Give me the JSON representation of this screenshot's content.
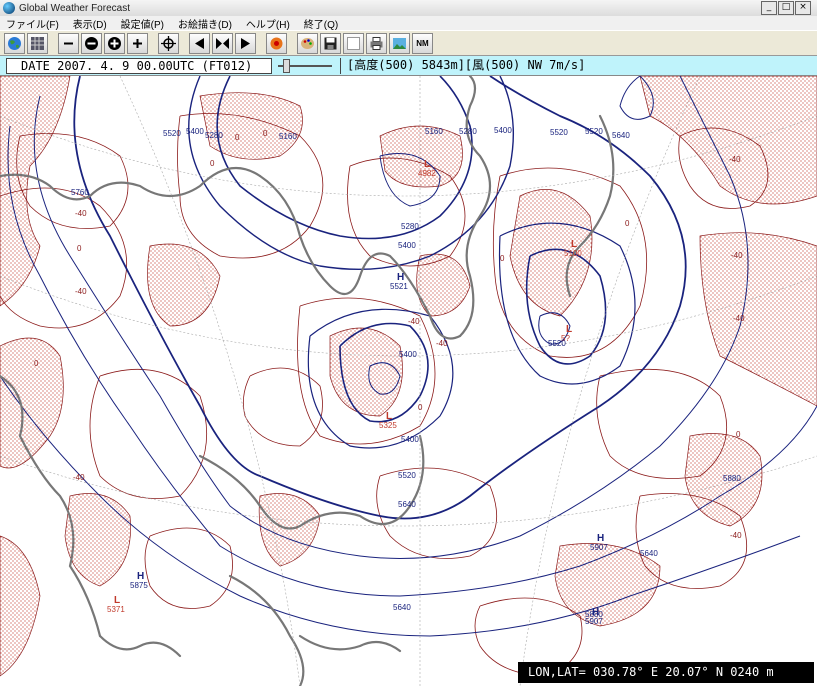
{
  "window": {
    "title": "Global Weather Forecast",
    "controls": [
      "_",
      "□",
      "×"
    ]
  },
  "menu": [
    "ファイル(F)",
    "表示(D)",
    "設定値(P)",
    "お絵描き(D)",
    "ヘルプ(H)",
    "終了(Q)"
  ],
  "toolbar": {
    "buttons": [
      "globe-icon",
      "grid-icon",
      "zoom-minus-icon",
      "zoom-out-icon",
      "zoom-in-icon",
      "zoom-plus-icon",
      "crosshair-icon",
      "prev-icon",
      "stop-icon",
      "next-icon",
      "settings-icon",
      "palette-icon",
      "save-icon",
      "blank-icon",
      "print-icon",
      "image-icon",
      "nm-icon"
    ],
    "nm_label": "NM"
  },
  "status": {
    "date": "DATE 2007. 4. 9 00.00UTC (FT012)",
    "info": "[高度(500) 5843m][風(500) NW  7m/s]"
  },
  "map": {
    "pressure_labels": [
      {
        "type": "L",
        "value": "4982"
      },
      {
        "type": "L",
        "value": "5100"
      },
      {
        "type": "L",
        "value": "5?"
      },
      {
        "type": "L",
        "value": "5325"
      },
      {
        "type": "L",
        "value": "5371"
      },
      {
        "type": "H",
        "value": "5521"
      },
      {
        "type": "H",
        "value": "5875"
      },
      {
        "type": "H",
        "value": "5907"
      },
      {
        "type": "H",
        "value": "5907"
      }
    ],
    "contour_labels": [
      "5520",
      "5400",
      "5280",
      "5160",
      "5160",
      "5280",
      "5400",
      "5520",
      "5640",
      "5760",
      "5280",
      "5400",
      "5400",
      "5400",
      "5520",
      "5640",
      "5880",
      "5640",
      "5880",
      "5520",
      "5520",
      "5640"
    ],
    "temp_labels": [
      "-40",
      "-40",
      "-40",
      "-40",
      "-40",
      "-40",
      "-40",
      "-40",
      "-40",
      "0",
      "0",
      "0",
      "0",
      "0",
      "0",
      "0",
      "0",
      "0"
    ],
    "colors": {
      "height": "#1a237e",
      "temp": "#8b1a1a",
      "coast": "#777777",
      "shading": "#c0392b"
    }
  },
  "coord": "LON,LAT= 030.78° E  20.07° N  0240 m"
}
